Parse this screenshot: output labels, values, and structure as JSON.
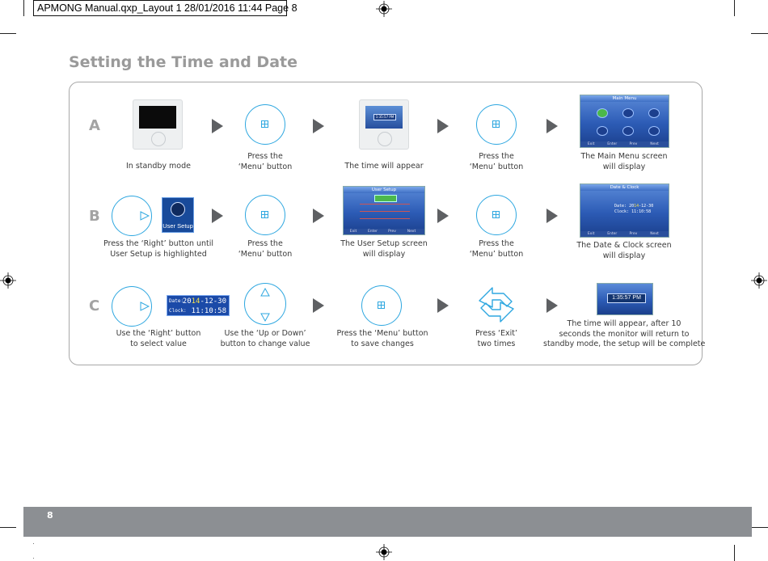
{
  "slug": "APMONG Manual.qxp_Layout 1  28/01/2016  11:44  Page 8",
  "title": "Setting the Time and Date",
  "rows": {
    "A": {
      "letter": "A",
      "captions": {
        "c1": [
          "In standby mode"
        ],
        "c2": [
          "Press the",
          "‘Menu’ button"
        ],
        "c3": [
          "The time will appear"
        ],
        "c4": [
          "Press the",
          "‘Menu’ button"
        ],
        "c5": [
          "The Main Menu screen",
          "will display"
        ]
      }
    },
    "B": {
      "letter": "B",
      "captions": {
        "c1": [
          "Press the ‘Right’ button until",
          "User Setup is highlighted"
        ],
        "c2": [
          "Press the",
          "‘Menu’ button"
        ],
        "c3": [
          "The User Setup screen",
          "will display"
        ],
        "c4": [
          "Press the",
          "‘Menu’ button"
        ],
        "c5": [
          "The Date & Clock screen",
          "will display"
        ]
      }
    },
    "C": {
      "letter": "C",
      "captions": {
        "c1": [
          "Use the ‘Right’ button",
          "to select value"
        ],
        "c2": [
          "Use the ‘Up or Down’",
          "button to change value"
        ],
        "c3": [
          "Press the ‘Menu’ button",
          "to save changes"
        ],
        "c4": [
          "Press ‘Exit’",
          "two times"
        ],
        "c5": [
          "The time will appear, after 10",
          "seconds the monitor will return to",
          "standby mode, the setup will be complete"
        ]
      }
    }
  },
  "screens": {
    "time_small": "1:35:57 PM",
    "main_menu": "Main Menu",
    "user_setup": "User Setup",
    "date_clock": "Date & Clock",
    "final_time": "1:35:57 PM",
    "footer_softkeys": [
      "Exit",
      "Enter",
      "Prev",
      "Next"
    ]
  },
  "user_setup_icon_label": "User Setup",
  "date_clock_box": {
    "date_key": "Date:",
    "date_pre": "20",
    "date_hl": "14",
    "date_post": "-12-30",
    "clock_key": "Clock:",
    "clock_val": "11:10:58"
  },
  "page_number": "8",
  "colors": {
    "accent": "#2ea7e0",
    "arrow": "#5e6063",
    "footer": "#8c8f93",
    "title": "#9a9a9a"
  }
}
